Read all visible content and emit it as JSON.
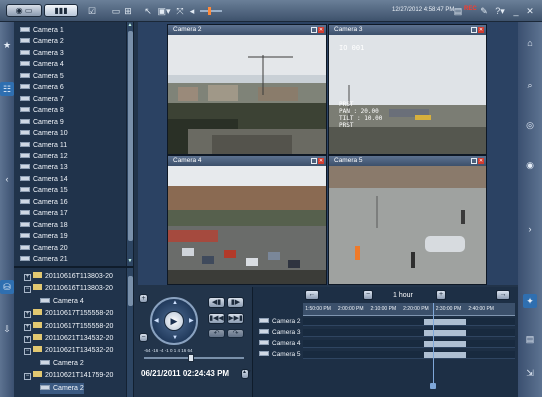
{
  "toolbar": {
    "datetime": "12/27/2012 4:58:47 PM",
    "record_label": "REC",
    "icons": [
      "live-mode-icon",
      "playback-mode-icon",
      "checkbox-icon",
      "single-layout-icon",
      "quad-layout-icon",
      "pointer-icon",
      "camera-layout-icon",
      "fullscreen-icon",
      "audio-icon",
      "volume-slider-icon",
      "monitor-icon",
      "wrench-icon",
      "help-icon",
      "minimize-icon",
      "close-icon"
    ]
  },
  "camera_list": {
    "items": [
      "Camera 1",
      "Camera 2",
      "Camera 3",
      "Camera 4",
      "Camera 5",
      "Camera 6",
      "Camera 7",
      "Camera 8",
      "Camera 9",
      "Camera 10",
      "Camera 11",
      "Camera 12",
      "Camera 13",
      "Camera 14",
      "Camera 15",
      "Camera 16",
      "Camera 17",
      "Camera 18",
      "Camera 19",
      "Camera 20",
      "Camera 21"
    ]
  },
  "recordings_tree": {
    "items": [
      {
        "label": "20110616T113803-20",
        "kind": "folder"
      },
      {
        "label": "20110616T113803-20",
        "kind": "folder"
      },
      {
        "label": "Camera 4",
        "kind": "camera"
      },
      {
        "label": "20110617T155558-20",
        "kind": "folder"
      },
      {
        "label": "20110617T155558-20",
        "kind": "folder"
      },
      {
        "label": "20110621T134532-20",
        "kind": "folder"
      },
      {
        "label": "20110621T134532-20",
        "kind": "folder"
      },
      {
        "label": "Camera 2",
        "kind": "camera"
      },
      {
        "label": "20110621T141759-20",
        "kind": "folder"
      },
      {
        "label": "Camera 2",
        "kind": "camera"
      }
    ]
  },
  "video_tiles": [
    {
      "title": "Camera 2",
      "osd": []
    },
    {
      "title": "Camera 3",
      "osd": [
        "IO 001",
        "PRST",
        "PAN : 20.00",
        "TILT : 10.00",
        "PRST"
      ]
    },
    {
      "title": "Camera 4",
      "osd": []
    },
    {
      "title": "Camera 5",
      "osd": []
    }
  ],
  "playback": {
    "speed_scale": "-64 -16 -4 -1 0 1 4 16 64",
    "date_time": "06/21/2011 02:24:43 PM"
  },
  "timeline": {
    "zoom_label": "1 hour",
    "ticks": [
      "1:50:00 PM",
      "2:00:00 PM",
      "2:10:00 PM",
      "2:20:00 PM",
      "2:30:00 PM",
      "2:40:00 PM"
    ],
    "tracks": [
      {
        "name": "Camera 2",
        "recorded": [
          [
            "2:22:00 PM",
            "2:35:00 PM"
          ]
        ]
      },
      {
        "name": "Camera 3",
        "recorded": [
          [
            "2:22:00 PM",
            "2:35:00 PM"
          ]
        ]
      },
      {
        "name": "Camera 4",
        "recorded": [
          [
            "2:22:00 PM",
            "2:35:00 PM"
          ]
        ]
      },
      {
        "name": "Camera 5",
        "recorded": [
          [
            "2:22:00 PM",
            "2:35:00 PM"
          ]
        ]
      }
    ],
    "cursor_time": "2:24:43 PM"
  },
  "colors": {
    "background": "#22344a",
    "panel": "#20334b",
    "accent": "#7fa7d8",
    "record": "#ff3a2a"
  }
}
